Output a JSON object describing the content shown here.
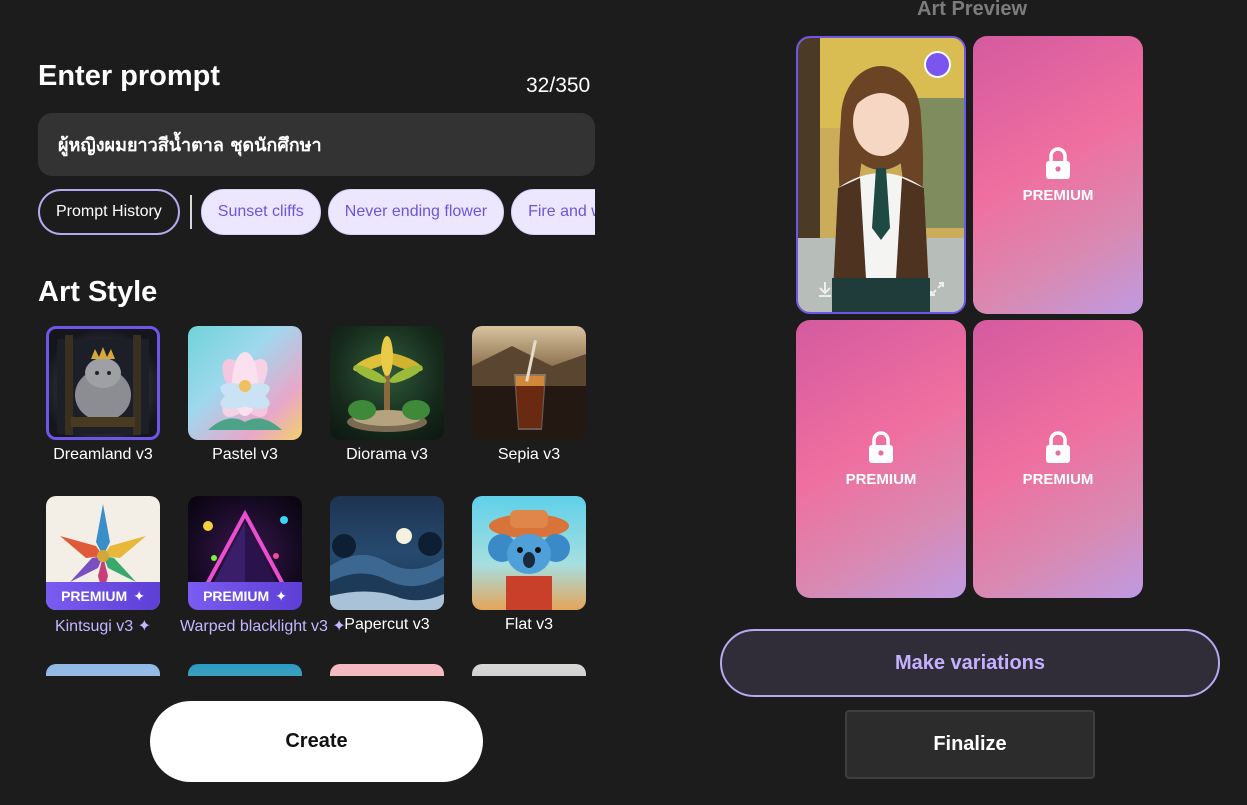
{
  "prompt": {
    "title": "Enter prompt",
    "char_count": "32/350",
    "value": "ผู้หญิงผมยาวสีน้ำตาล ชุดนักศึกษา",
    "history_label": "Prompt History",
    "suggestions": [
      "Sunset cliffs",
      "Never ending flower",
      "Fire and wa"
    ]
  },
  "art_style": {
    "title": "Art Style",
    "premium_tag": "PREMIUM",
    "items": [
      {
        "label": "Dreamland v3",
        "selected": true,
        "premium": false
      },
      {
        "label": "Pastel v3",
        "premium": false
      },
      {
        "label": "Diorama v3",
        "premium": false
      },
      {
        "label": "Sepia v3",
        "premium": false
      },
      {
        "label": "Kintsugi v3 ✦",
        "premium": true
      },
      {
        "label": "Warped blacklight v3 ✦",
        "premium": true
      },
      {
        "label": "Papercut v3",
        "premium": false
      },
      {
        "label": "Flat v3",
        "premium": false
      }
    ]
  },
  "create_label": "Create",
  "preview": {
    "title": "Art Preview",
    "premium_label": "PREMIUM"
  },
  "make_variations_label": "Make variations",
  "finalize_label": "Finalize"
}
